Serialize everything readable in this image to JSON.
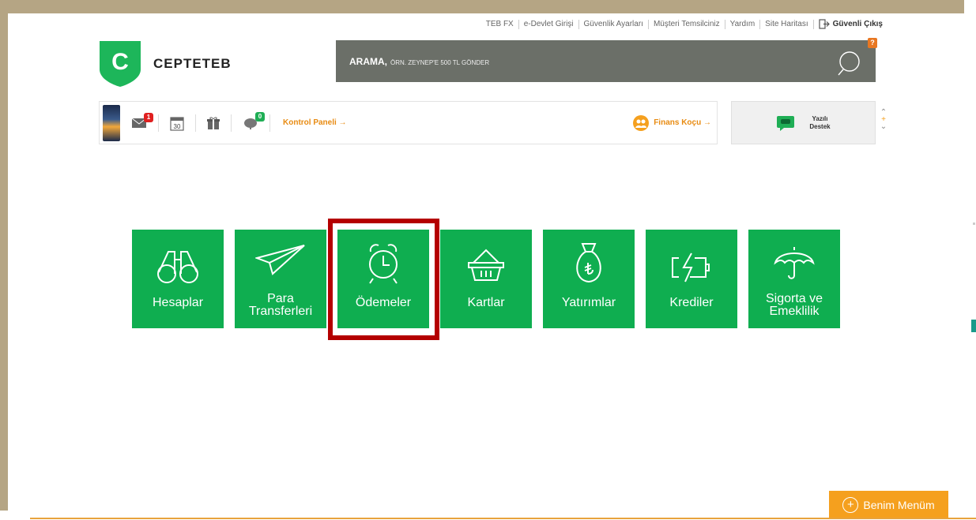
{
  "top_links": [
    "TEB FX",
    "e-Devlet Girişi",
    "Güvenlik Ayarları",
    "Müşteri Temsilciniz",
    "Yardım",
    "Site Haritası"
  ],
  "exit_label": "Güvenli Çıkış",
  "brand": {
    "name": "CEPTETEB",
    "letter": "C"
  },
  "search": {
    "label": "ARAMA,",
    "hint": "ÖRN. ZEYNEP'E 500 TL GÖNDER",
    "badge": "?"
  },
  "panel": {
    "mail_count": "1",
    "calendar_day": "30",
    "cloud_count": "0",
    "control_panel": "Kontrol Paneli →",
    "finans": "Finans Koçu →"
  },
  "support": {
    "line1": "Yazılı",
    "line2": "Destek"
  },
  "tiles": [
    {
      "label": "Hesaplar",
      "icon": "binoculars-icon"
    },
    {
      "label_1": "Para",
      "label_2": "Transferleri",
      "icon": "paper-plane-icon"
    },
    {
      "label": "Ödemeler",
      "icon": "alarm-clock-icon"
    },
    {
      "label": "Kartlar",
      "icon": "basket-icon"
    },
    {
      "label": "Yatırımlar",
      "icon": "money-bag-icon"
    },
    {
      "label": "Krediler",
      "icon": "battery-icon"
    },
    {
      "label_1": "Sigorta ve",
      "label_2": "Emeklilik",
      "icon": "umbrella-icon"
    }
  ],
  "menu_button": "Benim Menüm",
  "colors": {
    "tile_green": "#0fae50",
    "highlight": "#b40000",
    "accent_orange": "#f5a01e",
    "search_bg": "#6b6f68"
  }
}
